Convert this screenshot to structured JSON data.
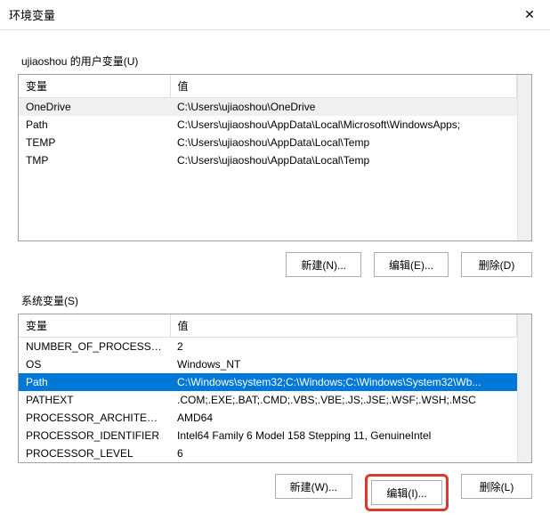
{
  "window": {
    "title": "环境变量",
    "close_glyph": "✕"
  },
  "user_section": {
    "label": "ujiaoshou 的用户变量(U)",
    "headers": {
      "name": "变量",
      "value": "值"
    },
    "rows": [
      {
        "name": "OneDrive",
        "value": "C:\\Users\\ujiaoshou\\OneDrive"
      },
      {
        "name": "Path",
        "value": "C:\\Users\\ujiaoshou\\AppData\\Local\\Microsoft\\WindowsApps;"
      },
      {
        "name": "TEMP",
        "value": "C:\\Users\\ujiaoshou\\AppData\\Local\\Temp"
      },
      {
        "name": "TMP",
        "value": "C:\\Users\\ujiaoshou\\AppData\\Local\\Temp"
      }
    ],
    "buttons": {
      "new": "新建(N)...",
      "edit": "编辑(E)...",
      "delete": "删除(D)"
    },
    "selected_index": 0
  },
  "system_section": {
    "label": "系统变量(S)",
    "headers": {
      "name": "变量",
      "value": "值"
    },
    "rows": [
      {
        "name": "NUMBER_OF_PROCESSORS",
        "value": "2"
      },
      {
        "name": "OS",
        "value": "Windows_NT"
      },
      {
        "name": "Path",
        "value": "C:\\Windows\\system32;C:\\Windows;C:\\Windows\\System32\\Wb..."
      },
      {
        "name": "PATHEXT",
        "value": ".COM;.EXE;.BAT;.CMD;.VBS;.VBE;.JS;.JSE;.WSF;.WSH;.MSC"
      },
      {
        "name": "PROCESSOR_ARCHITECT...",
        "value": "AMD64"
      },
      {
        "name": "PROCESSOR_IDENTIFIER",
        "value": "Intel64 Family 6 Model 158 Stepping 11, GenuineIntel"
      },
      {
        "name": "PROCESSOR_LEVEL",
        "value": "6"
      }
    ],
    "buttons": {
      "new": "新建(W)...",
      "edit": "编辑(I)...",
      "delete": "删除(L)"
    },
    "selected_index": 2
  }
}
